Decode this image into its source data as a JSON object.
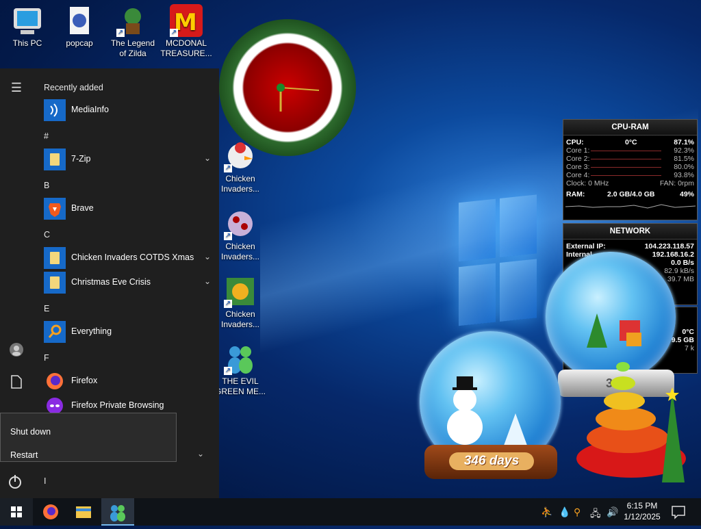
{
  "desktop_icons": [
    {
      "id": "this-pc",
      "label": "This PC"
    },
    {
      "id": "popcap",
      "label": "popcap"
    },
    {
      "id": "legend-zilda",
      "label": "The Legend of Zilda"
    },
    {
      "id": "mcdonal",
      "label": "MCDONAL TREASURE..."
    },
    {
      "id": "chicken-1",
      "label": "Chicken Invaders..."
    },
    {
      "id": "chicken-2",
      "label": "Chicken Invaders..."
    },
    {
      "id": "chicken-3",
      "label": "Chicken Invaders..."
    },
    {
      "id": "evil-green",
      "label": "THE EVIL GREEN ME..."
    }
  ],
  "start_menu": {
    "recently_added_label": "Recently added",
    "recent": "MediaInfo",
    "sections": {
      "hash": "#",
      "b": "B",
      "c": "C",
      "e": "E",
      "f": "F",
      "i": "I"
    },
    "apps": {
      "sevenzip": "7-Zip",
      "brave": "Brave",
      "chicken": "Chicken Invaders COTDS Xmas",
      "christmas": "Christmas Eve Crisis",
      "everything": "Everything",
      "firefox": "Firefox",
      "firefox_private": "Firefox Private Browsing"
    },
    "power_menu": {
      "shutdown": "Shut down",
      "restart": "Restart"
    }
  },
  "cpu_gadget": {
    "title": "CPU-RAM",
    "cpu_label": "CPU:",
    "cpu_temp": "0°C",
    "cpu_pct": "87.1%",
    "cores": [
      {
        "label": "Core 1:",
        "value": "92.3%"
      },
      {
        "label": "Core 2:",
        "value": "81.5%"
      },
      {
        "label": "Core 3:",
        "value": "80.0%"
      },
      {
        "label": "Core 4:",
        "value": "93.8%"
      }
    ],
    "clock": "Clock: 0 MHz",
    "fan": "FAN: 0rpm",
    "ram_label": "RAM:",
    "ram_used": "2.0 GB/4.0 GB",
    "ram_pct": "49%"
  },
  "network_gadget": {
    "title": "NETWORK",
    "external_label": "External IP:",
    "external_ip": "104.223.118.57",
    "internal_label": "Internal",
    "internal_ip": "192.168.16.2",
    "down": "0.0 B/s",
    "up": "82.9 kB/s",
    "total": "39.7 MB"
  },
  "extra_gadget": {
    "temp": "0°C",
    "size": "9.5 GB",
    "k": "7 k"
  },
  "snowglobe": {
    "days": "346 days",
    "badge": "346"
  },
  "taskbar": {
    "time": "6:15 PM",
    "date": "1/12/2025"
  },
  "colors": {
    "accent": "#1669c8",
    "start_bg": "#1f1f1f",
    "taskbar_bg": "#0f1318"
  }
}
